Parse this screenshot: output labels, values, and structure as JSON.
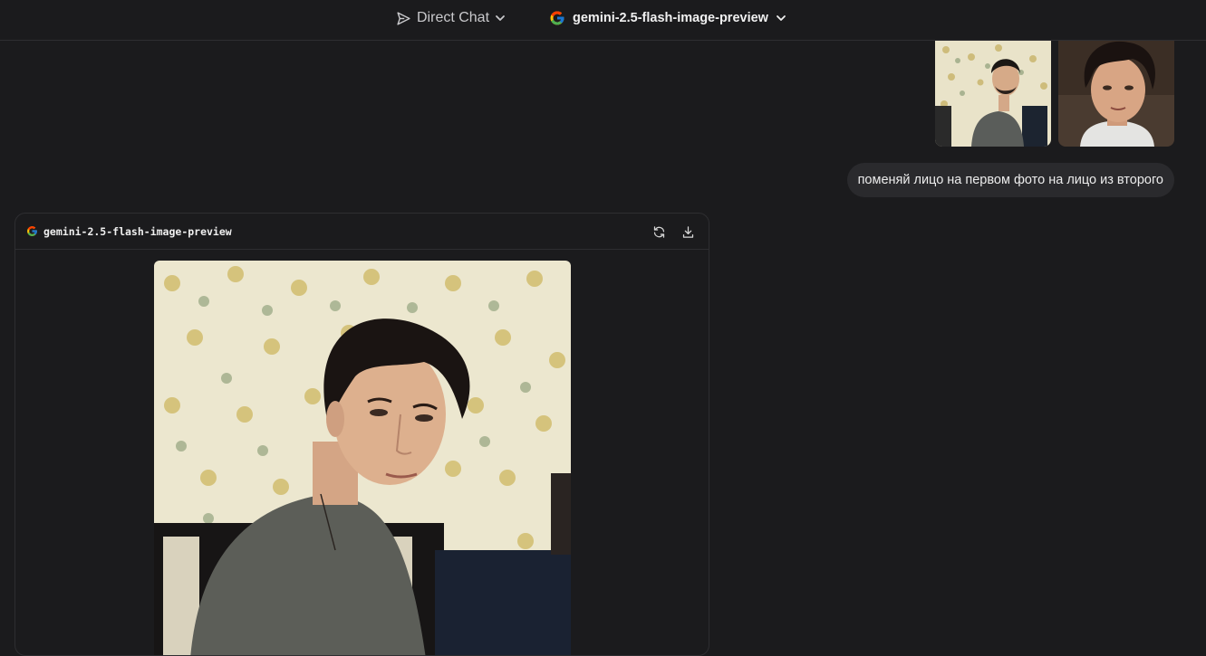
{
  "header": {
    "mode_label": "Direct Chat",
    "mode_icon": "send-icon",
    "model_label": "gemini-2.5-flash-image-preview",
    "model_icon": "google-g-icon"
  },
  "user_message": {
    "attachments": [
      {
        "icon": "image-thumbnail",
        "subject": "photo-1"
      },
      {
        "icon": "image-thumbnail",
        "subject": "photo-2"
      }
    ],
    "text": "поменяй лицо на первом фото на лицо из второго"
  },
  "assistant_message": {
    "model_label": "gemini-2.5-flash-image-preview",
    "actions": [
      "regenerate-icon",
      "download-icon"
    ]
  },
  "colors": {
    "background": "#1b1b1d",
    "border": "#2e2e31",
    "bubble": "#2a2a2d",
    "text": "#ececec"
  }
}
